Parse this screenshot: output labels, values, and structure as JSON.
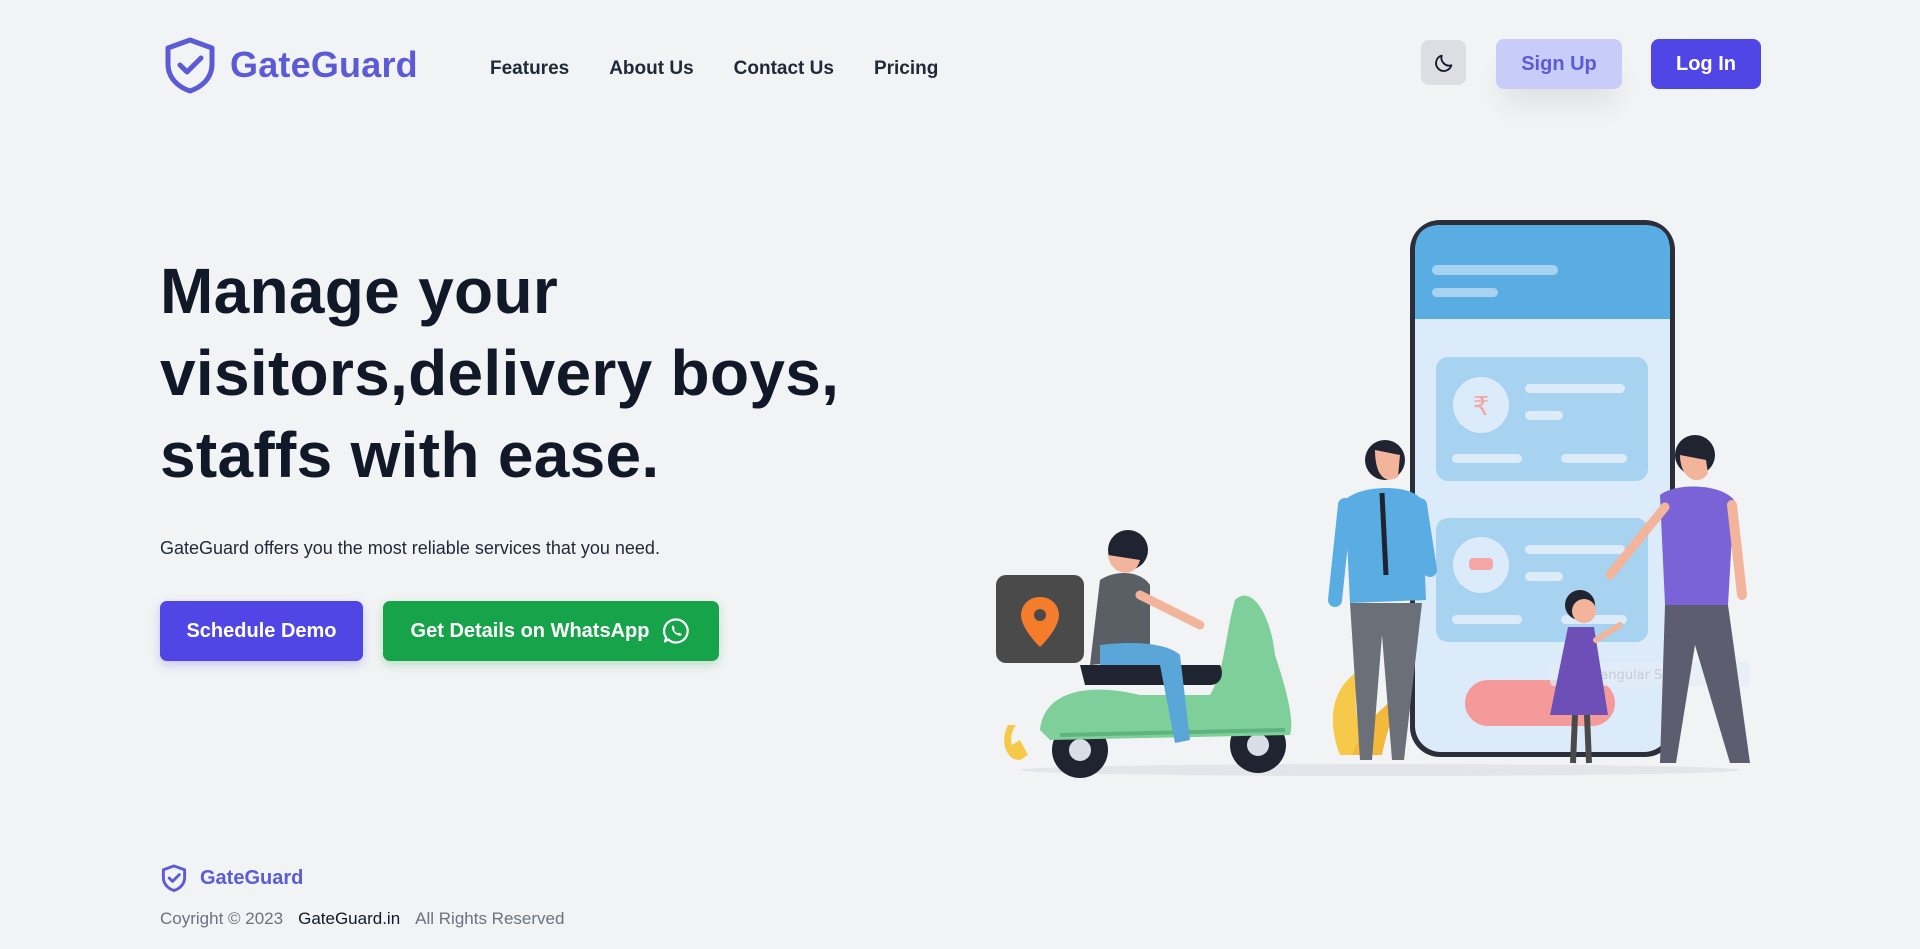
{
  "header": {
    "brand": "GateGuard",
    "nav": [
      "Features",
      "About Us",
      "Contact Us",
      "Pricing"
    ],
    "theme_toggle_icon": "moon-icon",
    "signup_label": "Sign Up",
    "login_label": "Log In"
  },
  "hero": {
    "title_lines": [
      "Manage your",
      "visitors,delivery boys,",
      "staffs with ease."
    ],
    "subtitle": "GateGuard offers you the most reliable services that you need.",
    "demo_label": "Schedule Demo",
    "whatsapp_label": "Get Details on WhatsApp"
  },
  "illustration": {
    "caption": "rectangular SI"
  },
  "footer": {
    "brand": "GateGuard",
    "copyright": "Coyright © 2023",
    "site": "GateGuard.in",
    "rights": "All Rights Reserved"
  },
  "colors": {
    "brand": "#5b5bd6",
    "primary": "#4f46e5",
    "whatsapp": "#16a34a",
    "background": "#f2f3f5"
  }
}
